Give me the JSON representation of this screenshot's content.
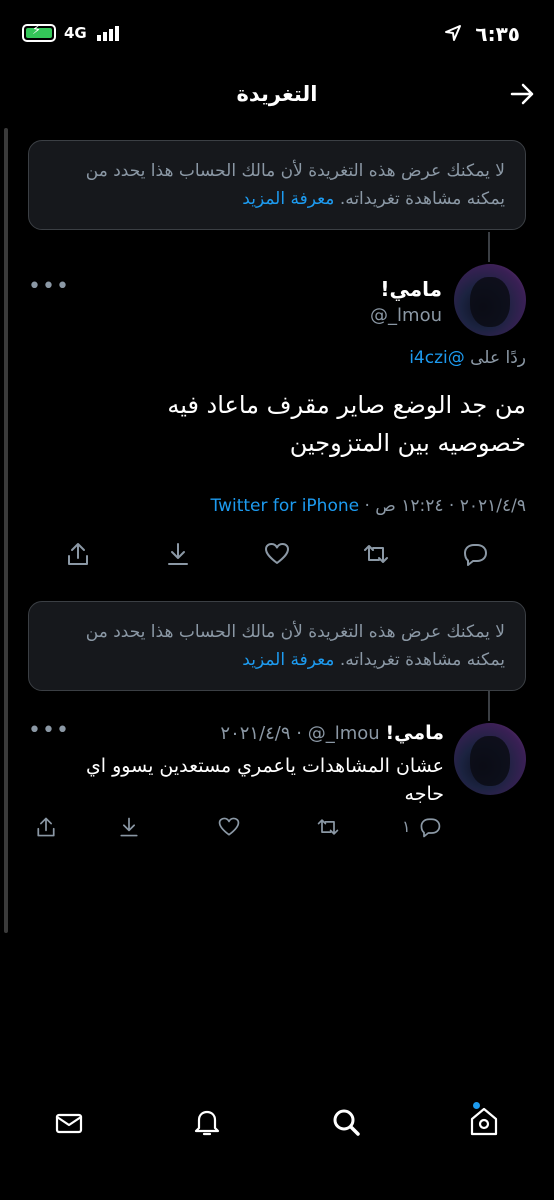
{
  "status_bar": {
    "time": "٦:٣٥",
    "network": "4G"
  },
  "header": {
    "title": "التغريدة"
  },
  "notice_1": {
    "text": "لا يمكنك عرض هذه التغريدة لأن مالك الحساب هذا يحدد من يمكنه مشاهدة تغريداته.",
    "link": "معرفة المزيد"
  },
  "main_tweet": {
    "name": "مامي!",
    "handle": "@_lmou",
    "reply_prefix": "ردًا على",
    "reply_to": "@i4czi",
    "text": "من جد الوضع صاير مقرف ماعاد فيه خصوصيه بين المتزوجين",
    "date": "٢٠٢١/٤/٩",
    "time": "١٢:٢٤ ص",
    "source": "Twitter for iPhone"
  },
  "notice_2": {
    "text": "لا يمكنك عرض هذه التغريدة لأن مالك الحساب هذا يحدد من يمكنه مشاهدة تغريداته.",
    "link": "معرفة المزيد"
  },
  "reply_tweet": {
    "name": "مامي!",
    "handle": "@_lmou",
    "date": "٢٠٢١/٤/٩",
    "text": "عشان المشاهدات ياعمري مستعدين يسوو اي حاجه",
    "reply_count": "١"
  },
  "icons": [
    "location-arrow-icon",
    "battery-icon",
    "signal-icon",
    "back-arrow-icon",
    "more-icon",
    "reply-icon",
    "retweet-icon",
    "like-icon",
    "bookmark-icon",
    "share-icon",
    "home-icon",
    "search-icon",
    "notifications-icon",
    "messages-icon"
  ],
  "colors": {
    "background": "#000000",
    "accent": "#1d9bf0",
    "muted": "#8b98a5",
    "notice_bg": "#16181c"
  }
}
